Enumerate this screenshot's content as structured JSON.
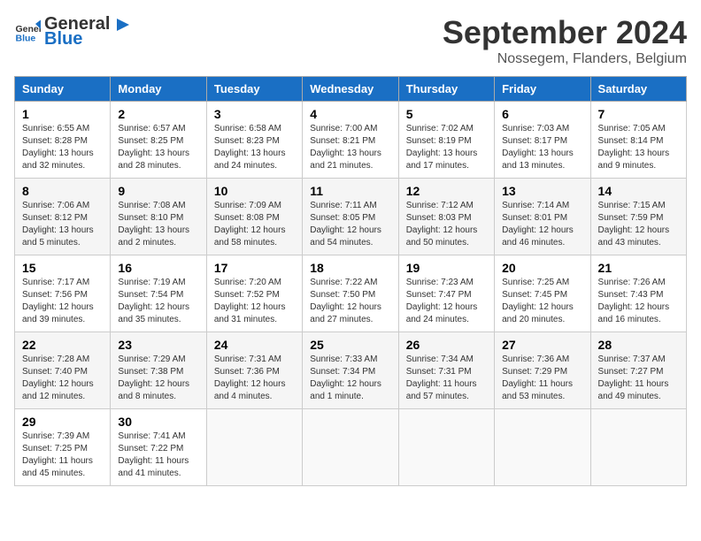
{
  "logo": {
    "text_general": "General",
    "text_blue": "Blue"
  },
  "title": {
    "month": "September 2024",
    "location": "Nossegem, Flanders, Belgium"
  },
  "headers": [
    "Sunday",
    "Monday",
    "Tuesday",
    "Wednesday",
    "Thursday",
    "Friday",
    "Saturday"
  ],
  "weeks": [
    [
      {
        "day": "1",
        "info": "Sunrise: 6:55 AM\nSunset: 8:28 PM\nDaylight: 13 hours\nand 32 minutes."
      },
      {
        "day": "2",
        "info": "Sunrise: 6:57 AM\nSunset: 8:25 PM\nDaylight: 13 hours\nand 28 minutes."
      },
      {
        "day": "3",
        "info": "Sunrise: 6:58 AM\nSunset: 8:23 PM\nDaylight: 13 hours\nand 24 minutes."
      },
      {
        "day": "4",
        "info": "Sunrise: 7:00 AM\nSunset: 8:21 PM\nDaylight: 13 hours\nand 21 minutes."
      },
      {
        "day": "5",
        "info": "Sunrise: 7:02 AM\nSunset: 8:19 PM\nDaylight: 13 hours\nand 17 minutes."
      },
      {
        "day": "6",
        "info": "Sunrise: 7:03 AM\nSunset: 8:17 PM\nDaylight: 13 hours\nand 13 minutes."
      },
      {
        "day": "7",
        "info": "Sunrise: 7:05 AM\nSunset: 8:14 PM\nDaylight: 13 hours\nand 9 minutes."
      }
    ],
    [
      {
        "day": "8",
        "info": "Sunrise: 7:06 AM\nSunset: 8:12 PM\nDaylight: 13 hours\nand 5 minutes."
      },
      {
        "day": "9",
        "info": "Sunrise: 7:08 AM\nSunset: 8:10 PM\nDaylight: 13 hours\nand 2 minutes."
      },
      {
        "day": "10",
        "info": "Sunrise: 7:09 AM\nSunset: 8:08 PM\nDaylight: 12 hours\nand 58 minutes."
      },
      {
        "day": "11",
        "info": "Sunrise: 7:11 AM\nSunset: 8:05 PM\nDaylight: 12 hours\nand 54 minutes."
      },
      {
        "day": "12",
        "info": "Sunrise: 7:12 AM\nSunset: 8:03 PM\nDaylight: 12 hours\nand 50 minutes."
      },
      {
        "day": "13",
        "info": "Sunrise: 7:14 AM\nSunset: 8:01 PM\nDaylight: 12 hours\nand 46 minutes."
      },
      {
        "day": "14",
        "info": "Sunrise: 7:15 AM\nSunset: 7:59 PM\nDaylight: 12 hours\nand 43 minutes."
      }
    ],
    [
      {
        "day": "15",
        "info": "Sunrise: 7:17 AM\nSunset: 7:56 PM\nDaylight: 12 hours\nand 39 minutes."
      },
      {
        "day": "16",
        "info": "Sunrise: 7:19 AM\nSunset: 7:54 PM\nDaylight: 12 hours\nand 35 minutes."
      },
      {
        "day": "17",
        "info": "Sunrise: 7:20 AM\nSunset: 7:52 PM\nDaylight: 12 hours\nand 31 minutes."
      },
      {
        "day": "18",
        "info": "Sunrise: 7:22 AM\nSunset: 7:50 PM\nDaylight: 12 hours\nand 27 minutes."
      },
      {
        "day": "19",
        "info": "Sunrise: 7:23 AM\nSunset: 7:47 PM\nDaylight: 12 hours\nand 24 minutes."
      },
      {
        "day": "20",
        "info": "Sunrise: 7:25 AM\nSunset: 7:45 PM\nDaylight: 12 hours\nand 20 minutes."
      },
      {
        "day": "21",
        "info": "Sunrise: 7:26 AM\nSunset: 7:43 PM\nDaylight: 12 hours\nand 16 minutes."
      }
    ],
    [
      {
        "day": "22",
        "info": "Sunrise: 7:28 AM\nSunset: 7:40 PM\nDaylight: 12 hours\nand 12 minutes."
      },
      {
        "day": "23",
        "info": "Sunrise: 7:29 AM\nSunset: 7:38 PM\nDaylight: 12 hours\nand 8 minutes."
      },
      {
        "day": "24",
        "info": "Sunrise: 7:31 AM\nSunset: 7:36 PM\nDaylight: 12 hours\nand 4 minutes."
      },
      {
        "day": "25",
        "info": "Sunrise: 7:33 AM\nSunset: 7:34 PM\nDaylight: 12 hours\nand 1 minute."
      },
      {
        "day": "26",
        "info": "Sunrise: 7:34 AM\nSunset: 7:31 PM\nDaylight: 11 hours\nand 57 minutes."
      },
      {
        "day": "27",
        "info": "Sunrise: 7:36 AM\nSunset: 7:29 PM\nDaylight: 11 hours\nand 53 minutes."
      },
      {
        "day": "28",
        "info": "Sunrise: 7:37 AM\nSunset: 7:27 PM\nDaylight: 11 hours\nand 49 minutes."
      }
    ],
    [
      {
        "day": "29",
        "info": "Sunrise: 7:39 AM\nSunset: 7:25 PM\nDaylight: 11 hours\nand 45 minutes."
      },
      {
        "day": "30",
        "info": "Sunrise: 7:41 AM\nSunset: 7:22 PM\nDaylight: 11 hours\nand 41 minutes."
      },
      {
        "day": "",
        "info": ""
      },
      {
        "day": "",
        "info": ""
      },
      {
        "day": "",
        "info": ""
      },
      {
        "day": "",
        "info": ""
      },
      {
        "day": "",
        "info": ""
      }
    ]
  ]
}
